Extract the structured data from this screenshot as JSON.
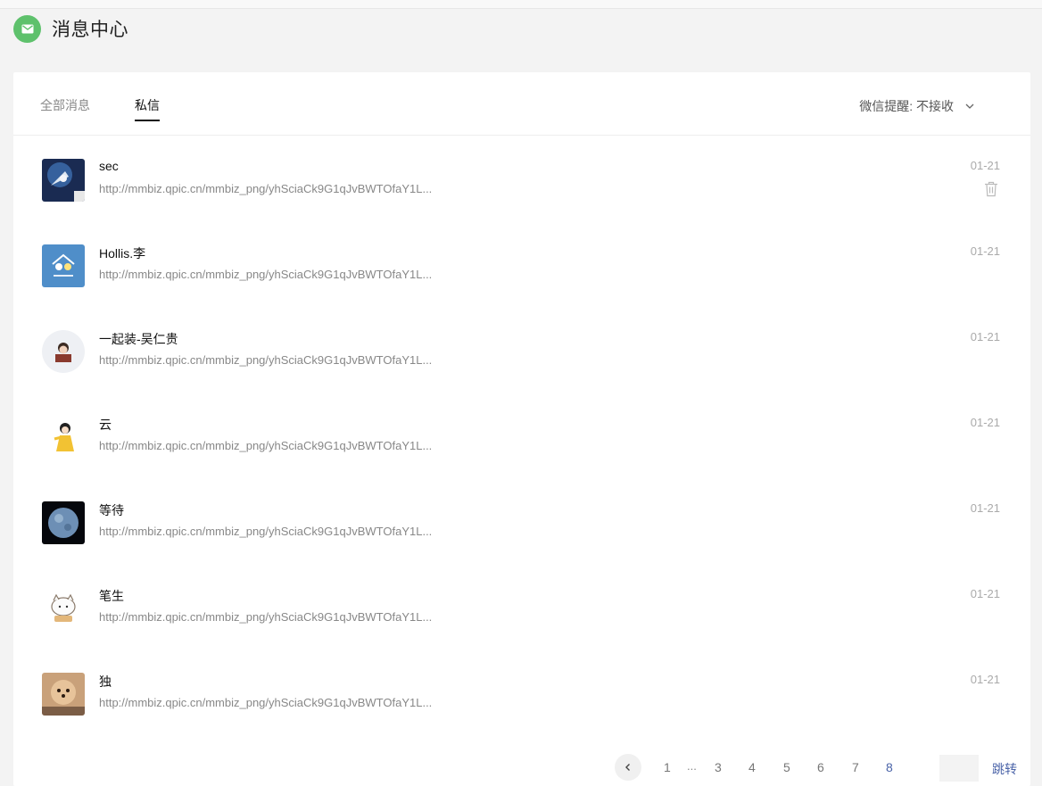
{
  "header": {
    "title": "消息中心",
    "logo_icon": "mail-icon",
    "logo_color": "#5ec16c"
  },
  "tabs": [
    {
      "label": "全部消息",
      "active": false
    },
    {
      "label": "私信",
      "active": true
    }
  ],
  "wechat_remind": {
    "label": "微信提醒: 不接收",
    "icon": "chevron-down-icon"
  },
  "messages": [
    {
      "name": "sec",
      "text": "http://mmbiz.qpic.cn/mmbiz_png/yhSciaCk9G1qJvBWTOfaY1L...",
      "date": "01-21"
    },
    {
      "name": "Hollis.李",
      "text": "http://mmbiz.qpic.cn/mmbiz_png/yhSciaCk9G1qJvBWTOfaY1L...",
      "date": "01-21"
    },
    {
      "name": "一起装-吴仁贵",
      "text": "http://mmbiz.qpic.cn/mmbiz_png/yhSciaCk9G1qJvBWTOfaY1L...",
      "date": "01-21"
    },
    {
      "name": "云",
      "text": "http://mmbiz.qpic.cn/mmbiz_png/yhSciaCk9G1qJvBWTOfaY1L...",
      "date": "01-21"
    },
    {
      "name": "等待",
      "text": "http://mmbiz.qpic.cn/mmbiz_png/yhSciaCk9G1qJvBWTOfaY1L...",
      "date": "01-21"
    },
    {
      "name": "笔生",
      "text": "http://mmbiz.qpic.cn/mmbiz_png/yhSciaCk9G1qJvBWTOfaY1L...",
      "date": "01-21"
    },
    {
      "name": "独",
      "text": "http://mmbiz.qpic.cn/mmbiz_png/yhSciaCk9G1qJvBWTOfaY1L...",
      "date": "01-21"
    }
  ],
  "pagination": {
    "prev_icon": "chevron-left-icon",
    "pages": [
      "1",
      "3",
      "4",
      "5",
      "6",
      "7",
      "8"
    ],
    "ellipsis": "...",
    "current": "8",
    "jump_input_value": "",
    "jump_label": "跳转"
  }
}
